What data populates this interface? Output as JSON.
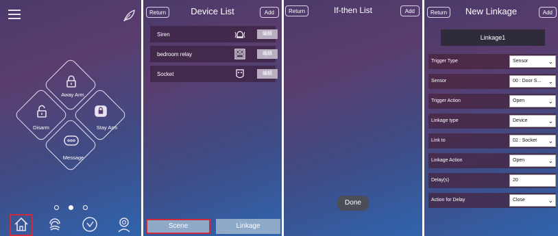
{
  "home": {
    "buttons": [
      {
        "label": "Away Arm"
      },
      {
        "label": "Disarm"
      },
      {
        "label": "Stay Arm"
      },
      {
        "label": "Message"
      }
    ],
    "nav": [
      "home-icon",
      "fingerprint-icon",
      "dial-icon",
      "user-icon"
    ]
  },
  "device_list": {
    "return_label": "Return",
    "title": "Device  List",
    "add_label": "Add",
    "edit_label": "编辑",
    "devices": [
      {
        "name": "Siren",
        "icon": "siren-icon"
      },
      {
        "name": "bedroom relay",
        "icon": "relay-icon"
      },
      {
        "name": "Socket",
        "icon": "socket-icon"
      }
    ],
    "tabs": {
      "scene": "Scene",
      "linkage": "Linkage"
    }
  },
  "ifthen": {
    "return_label": "Return",
    "title": "If-then List",
    "add_label": "Add",
    "done_label": "Done"
  },
  "new_linkage": {
    "return_label": "Return",
    "title": "New Linkage",
    "add_label": "Add",
    "name": "Linkage1",
    "rows": [
      {
        "label": "Trigger Type",
        "value": "Sensor",
        "dropdown": true
      },
      {
        "label": "Sensor",
        "value": "00 : Door S...",
        "dropdown": true
      },
      {
        "label": "Trigger Action",
        "value": "Open",
        "dropdown": true
      },
      {
        "label": "Linkage type",
        "value": "Device",
        "dropdown": true
      },
      {
        "label": "Link to",
        "value": "02 : Socket",
        "dropdown": true
      },
      {
        "label": "Linkage Action",
        "value": "Open",
        "dropdown": true
      },
      {
        "label": "Delay(s)",
        "value": "20",
        "dropdown": false
      },
      {
        "label": "Action for Delay",
        "value": "Close",
        "dropdown": true
      }
    ]
  }
}
